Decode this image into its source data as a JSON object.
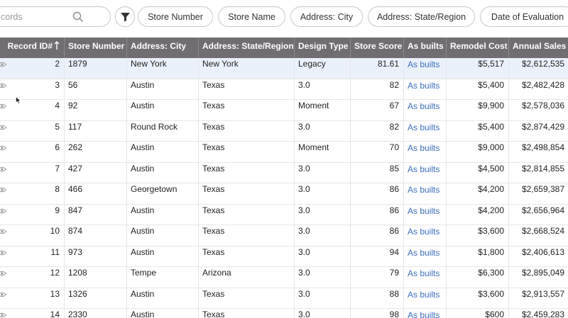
{
  "toolbar": {
    "search_placeholder": "cords",
    "chips": [
      "Store Number",
      "Store Name",
      "Address: City",
      "Address: State/Region",
      "Date of Evaluation"
    ]
  },
  "table": {
    "columns": [
      "Record ID#",
      "Store Number",
      "Address: City",
      "Address: State/Region",
      "Design Type",
      "Store Score",
      "As builts",
      "Remodel Cost",
      "Annual Sales"
    ],
    "rows": [
      [
        "2",
        "1879",
        "New York",
        "New York",
        "Legacy",
        "81.61",
        "As builts",
        "$5,517",
        "$2,612,535"
      ],
      [
        "3",
        "56",
        "Austin",
        "Texas",
        "3.0",
        "82",
        "As builts",
        "$5,400",
        "$2,482,428"
      ],
      [
        "4",
        "92",
        "Austin",
        "Texas",
        "Moment",
        "67",
        "As builts",
        "$9,900",
        "$2,578,036"
      ],
      [
        "5",
        "117",
        "Round Rock",
        "Texas",
        "3.0",
        "82",
        "As builts",
        "$5,400",
        "$2,874,429"
      ],
      [
        "6",
        "262",
        "Austin",
        "Texas",
        "Moment",
        "70",
        "As builts",
        "$9,000",
        "$2,498,854"
      ],
      [
        "7",
        "427",
        "Austin",
        "Texas",
        "3.0",
        "85",
        "As builts",
        "$4,500",
        "$2,814,855"
      ],
      [
        "8",
        "466",
        "Georgetown",
        "Texas",
        "3.0",
        "86",
        "As builts",
        "$4,200",
        "$2,659,387"
      ],
      [
        "9",
        "847",
        "Austin",
        "Texas",
        "3.0",
        "86",
        "As builts",
        "$4,200",
        "$2,656,964"
      ],
      [
        "10",
        "874",
        "Austin",
        "Texas",
        "3.0",
        "86",
        "As builts",
        "$3,600",
        "$2,668,524"
      ],
      [
        "11",
        "973",
        "Austin",
        "Texas",
        "3.0",
        "94",
        "As builts",
        "$1,800",
        "$2,406,613"
      ],
      [
        "12",
        "1208",
        "Tempe",
        "Arizona",
        "3.0",
        "79",
        "As builts",
        "$6,300",
        "$2,895,049"
      ],
      [
        "13",
        "1326",
        "Austin",
        "Texas",
        "3.0",
        "88",
        "As builts",
        "$3,600",
        "$2,913,557"
      ],
      [
        "14",
        "2330",
        "Austin",
        "Texas",
        "3.0",
        "98",
        "As builts",
        "$600",
        "$2,459,283"
      ]
    ]
  }
}
